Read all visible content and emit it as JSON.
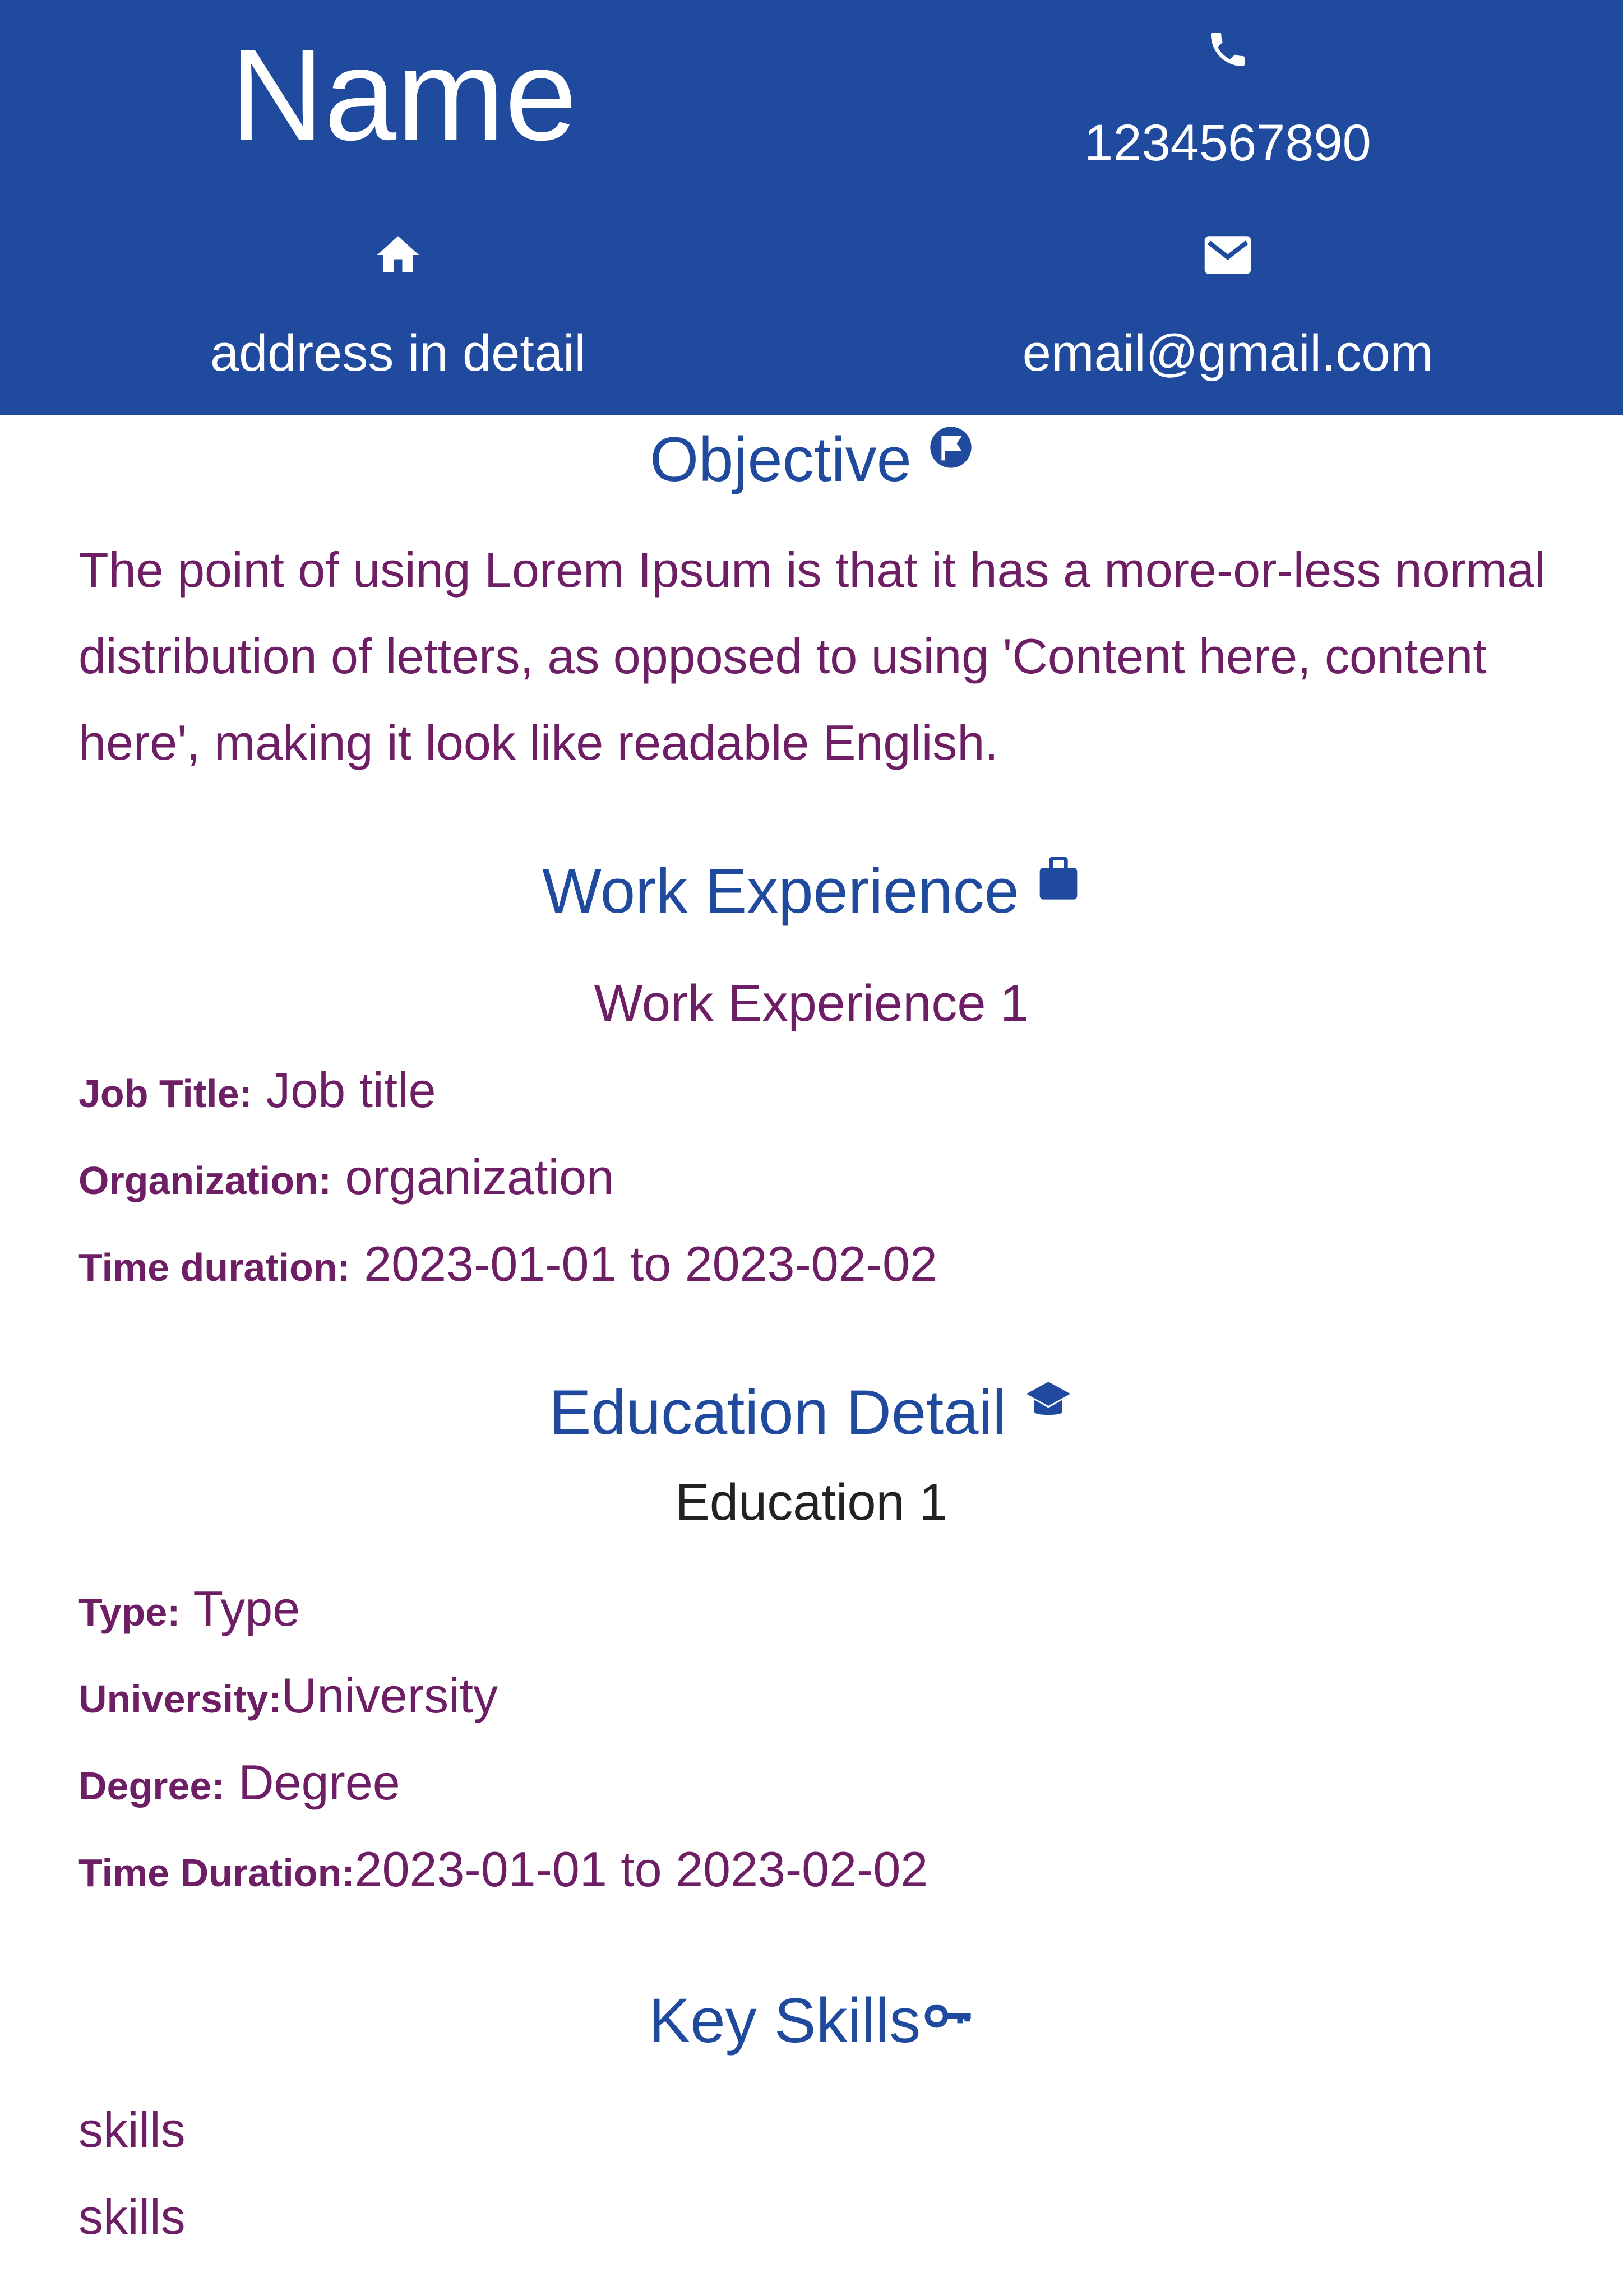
{
  "header": {
    "name": "Name",
    "phone": "1234567890",
    "address": "address in detail",
    "email": "email@gmail.com",
    "icons": {
      "phone": "phone-icon",
      "home": "home-icon",
      "email": "envelope-icon"
    }
  },
  "objective": {
    "title": "Objective",
    "icon": "flag-circle-icon",
    "text": "The point of using Lorem Ipsum is that it has a more-or-less normal distribution of letters, as opposed to using 'Content here, content here', making it look like readable English."
  },
  "work": {
    "title": "Work Experience",
    "icon": "briefcase-icon",
    "items": [
      {
        "heading": "Work Experience 1",
        "job_label": "Job Title:",
        "job_value": " Job title",
        "org_label": "Organization:",
        "org_value": " organization",
        "time_label": "Time duration:",
        "time_value": " 2023-01-01 to 2023-02-02"
      }
    ]
  },
  "education": {
    "title": "Education Detail",
    "icon": "graduation-cap-icon",
    "items": [
      {
        "heading": "Education 1",
        "type_label": "Type:",
        "type_value": " Type",
        "uni_label": "University:",
        "uni_value": "University",
        "degree_label": "Degree:",
        "degree_value": " Degree",
        "time_label": "Time Duration:",
        "time_value": "2023-01-01 to 2023-02-02"
      }
    ]
  },
  "skills": {
    "title": "Key Skills",
    "icon": "key-icon",
    "items": [
      "skills",
      "skills"
    ]
  },
  "colors": {
    "header_bg": "#1f4a9e",
    "heading_blue": "#1f4a9e",
    "body_text": "#6d1e64"
  }
}
